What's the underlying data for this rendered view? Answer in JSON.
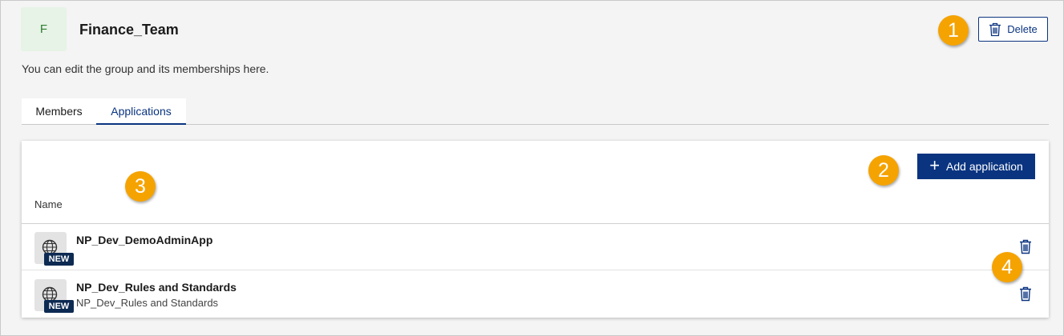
{
  "group": {
    "avatar_letter": "F",
    "name": "Finance_Team",
    "description": "You can edit the group and its memberships here."
  },
  "header": {
    "delete_label": "Delete",
    "delete_icon": "trash-icon"
  },
  "tabs": [
    {
      "label": "Members",
      "active": false
    },
    {
      "label": "Applications",
      "active": true
    }
  ],
  "applications": {
    "add_button_label": "Add application",
    "add_icon": "plus-icon",
    "column_header": "Name",
    "rows": [
      {
        "name": "NP_Dev_DemoAdminApp",
        "subtitle": "",
        "badge": "NEW",
        "icon": "globe-icon"
      },
      {
        "name": "NP_Dev_Rules and Standards",
        "subtitle": "NP_Dev_Rules and Standards",
        "badge": "NEW",
        "icon": "globe-icon"
      }
    ]
  },
  "callouts": [
    "1",
    "2",
    "3",
    "4"
  ],
  "colors": {
    "primary": "#0a3480",
    "callout": "#f5a300",
    "avatar_bg": "#e6f3e6",
    "avatar_text": "#2e7d32",
    "badge": "#0d2a52"
  }
}
